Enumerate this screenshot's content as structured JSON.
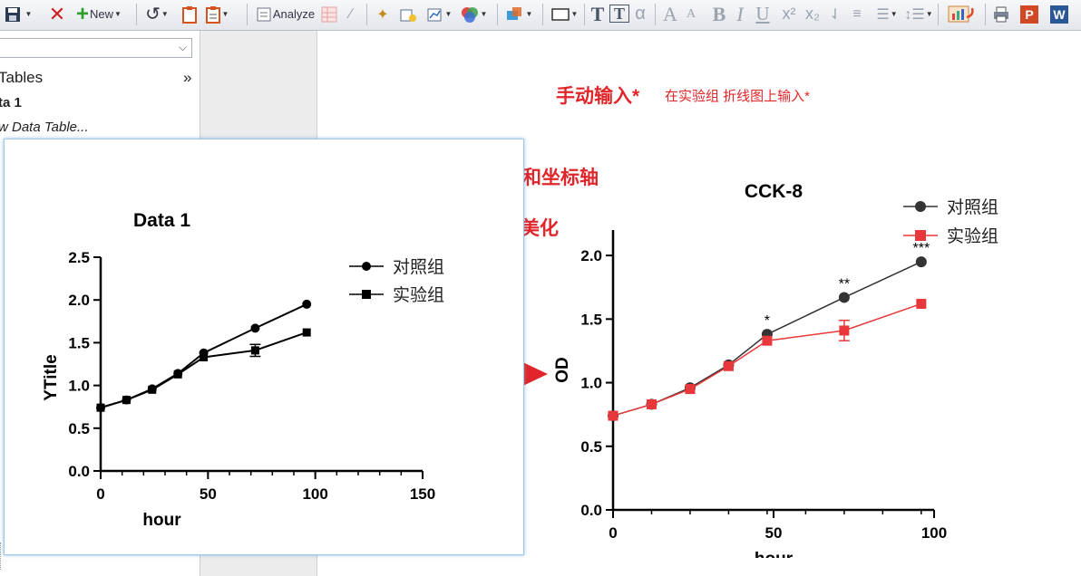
{
  "toolbar": {
    "new_label": "New",
    "analyze_label": "Analyze",
    "powerpoint_letter": "P",
    "word_letter": "W",
    "font_buttons": [
      "T",
      "T",
      "α",
      "A",
      "A",
      "B",
      "I",
      "U",
      "x²",
      "x₂"
    ]
  },
  "navigator": {
    "section_title": "Tables",
    "expand_symbol": "»",
    "item_data": "ta 1",
    "item_new_table": "w Data Table..."
  },
  "annotations": {
    "manual_input": "手动输入*",
    "manual_input_note": "在实验组 折线图上输入*",
    "change_title_axes": "改题目和坐标轴",
    "color_beautify": "颜色美化"
  },
  "chart_data": [
    {
      "type": "line",
      "title": "Data 1",
      "xlabel": "hour",
      "ylabel": "YTitle",
      "xlim": [
        0,
        150
      ],
      "ylim": [
        0,
        2.5
      ],
      "x_ticks": [
        "0",
        "50",
        "100",
        "150"
      ],
      "y_ticks": [
        "0.0",
        "0.5",
        "1.0",
        "1.5",
        "2.0",
        "2.5"
      ],
      "grid": false,
      "legend_position": "top-right",
      "series": [
        {
          "name": "对照组",
          "marker": "circle",
          "color": "#000000",
          "x": [
            0,
            12,
            24,
            36,
            48,
            72,
            96
          ],
          "y": [
            0.74,
            0.83,
            0.96,
            1.14,
            1.38,
            1.67,
            1.95
          ]
        },
        {
          "name": "实验组",
          "marker": "square",
          "color": "#000000",
          "x": [
            0,
            12,
            24,
            36,
            48,
            72,
            96
          ],
          "y": [
            0.74,
            0.83,
            0.95,
            1.13,
            1.33,
            1.41,
            1.62
          ],
          "error": [
            0,
            0,
            0,
            0,
            0,
            0.07,
            0
          ]
        }
      ]
    },
    {
      "type": "line",
      "title": "CCK-8",
      "xlabel": "hour",
      "ylabel": "OD",
      "xlim": [
        0,
        100
      ],
      "ylim": [
        0,
        2.2
      ],
      "x_ticks": [
        "0",
        "50",
        "100"
      ],
      "y_ticks": [
        "0.0",
        "0.5",
        "1.0",
        "1.5",
        "2.0"
      ],
      "grid": false,
      "legend_position": "top-right",
      "series": [
        {
          "name": "对照组",
          "marker": "circle",
          "color": "#333333",
          "x": [
            0,
            12,
            24,
            36,
            48,
            72,
            96
          ],
          "y": [
            0.74,
            0.83,
            0.96,
            1.14,
            1.38,
            1.67,
            1.95
          ]
        },
        {
          "name": "实验组",
          "marker": "square",
          "color": "#e8383b",
          "x": [
            0,
            12,
            24,
            36,
            48,
            72,
            96
          ],
          "y": [
            0.74,
            0.83,
            0.95,
            1.13,
            1.33,
            1.41,
            1.62
          ],
          "error": [
            0,
            0,
            0,
            0,
            0,
            0.08,
            0
          ]
        }
      ],
      "significance": [
        {
          "x": 48,
          "label": "*"
        },
        {
          "x": 72,
          "label": "**"
        },
        {
          "x": 96,
          "label": "***"
        }
      ]
    }
  ]
}
